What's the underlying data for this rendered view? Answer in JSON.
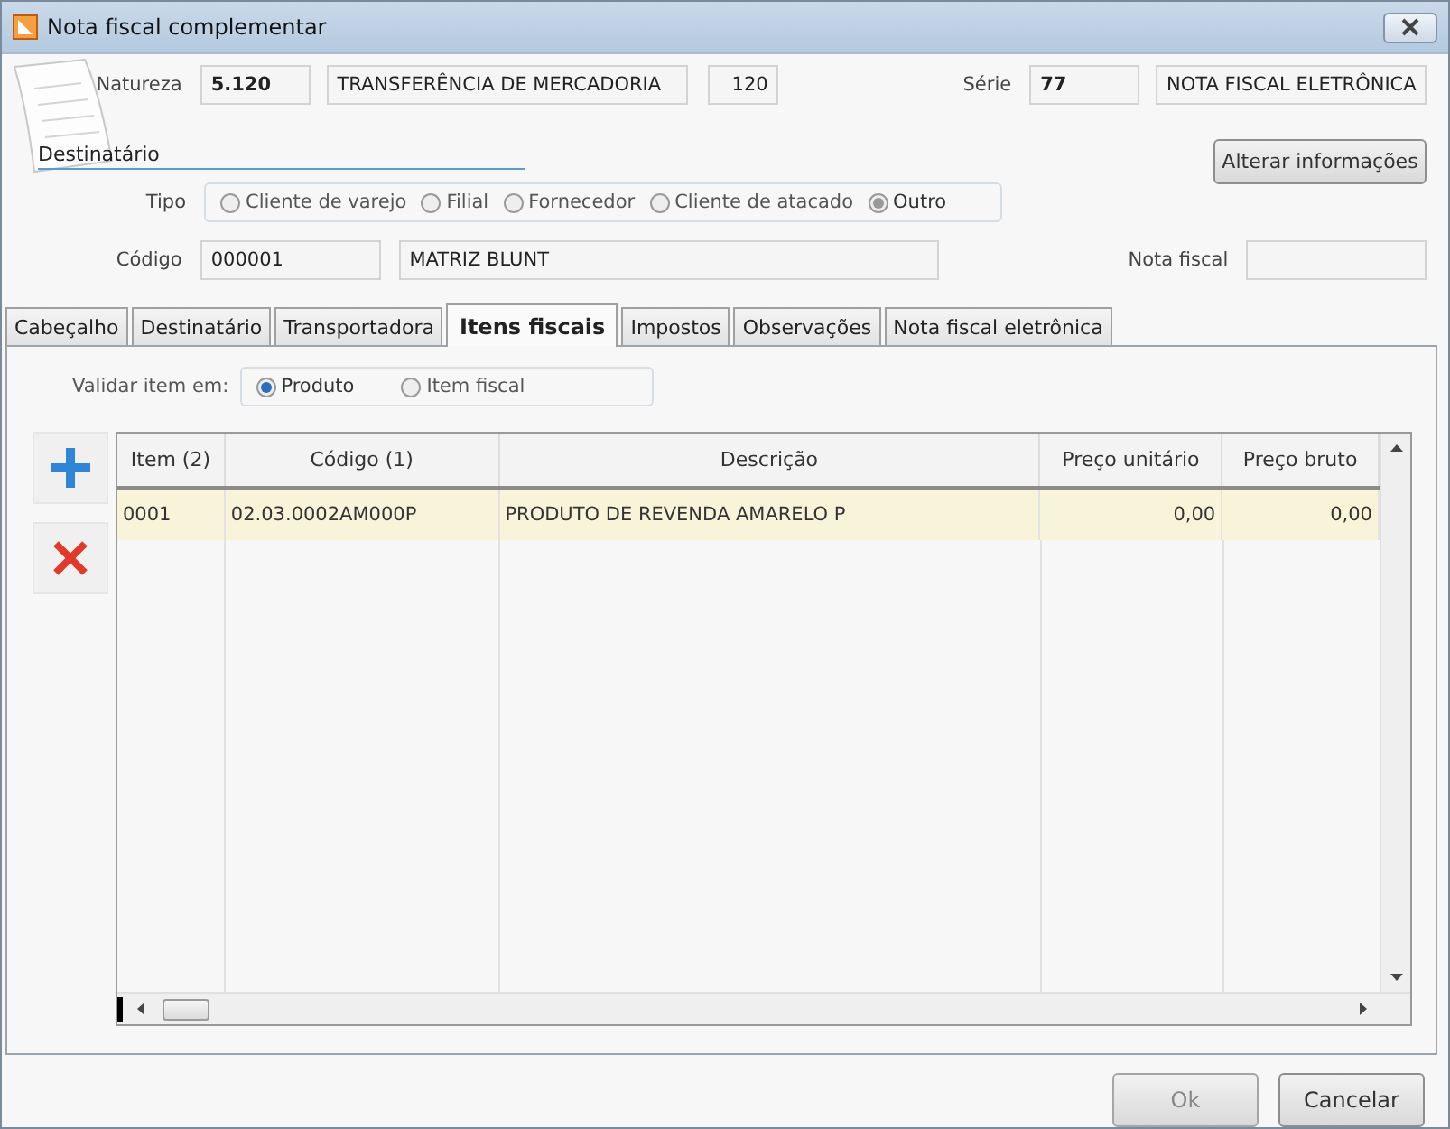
{
  "window": {
    "title": "Nota fiscal complementar"
  },
  "natureza": {
    "label": "Natureza",
    "code": "5.120",
    "description": "TRANSFERÊNCIA DE MERCADORIA",
    "number": "120"
  },
  "serie": {
    "label": "Série",
    "code": "77",
    "description": "NOTA FISCAL ELETRÔNICA"
  },
  "destinatario": {
    "heading": "Destinatário",
    "change_button": "Alterar informações",
    "tipo": {
      "label": "Tipo",
      "options": [
        {
          "label": "Cliente de varejo",
          "selected": false
        },
        {
          "label": "Filial",
          "selected": false
        },
        {
          "label": "Fornecedor",
          "selected": false
        },
        {
          "label": "Cliente de atacado",
          "selected": false
        },
        {
          "label": "Outro",
          "selected": true
        }
      ]
    },
    "codigo": {
      "label": "Código",
      "code": "000001",
      "name": "MATRIZ BLUNT"
    },
    "nota_fiscal": {
      "label": "Nota fiscal"
    }
  },
  "tabs": [
    {
      "label": "Cabeçalho",
      "selected": false
    },
    {
      "label": "Destinatário",
      "selected": false
    },
    {
      "label": "Transportadora",
      "selected": false
    },
    {
      "label": "Itens fiscais",
      "selected": true
    },
    {
      "label": "Impostos",
      "selected": false
    },
    {
      "label": "Observações",
      "selected": false
    },
    {
      "label": "Nota fiscal eletrônica",
      "selected": false
    }
  ],
  "validar": {
    "label": "Validar item em:",
    "options": [
      {
        "label": "Produto",
        "selected": true
      },
      {
        "label": "Item fiscal",
        "selected": false
      }
    ]
  },
  "table": {
    "columns": [
      "Item (2)",
      "Código (1)",
      "Descrição",
      "Preço unitário",
      "Preço bruto"
    ],
    "rows": [
      {
        "cells": [
          "0001",
          "02.03.0002AM000P",
          "PRODUTO DE REVENDA AMARELO P",
          "0,00",
          "0,00"
        ],
        "selected": true
      }
    ]
  },
  "buttons": [
    {
      "label": "Ok",
      "disabled": true
    },
    {
      "label": "Cancelar",
      "disabled": false
    }
  ]
}
